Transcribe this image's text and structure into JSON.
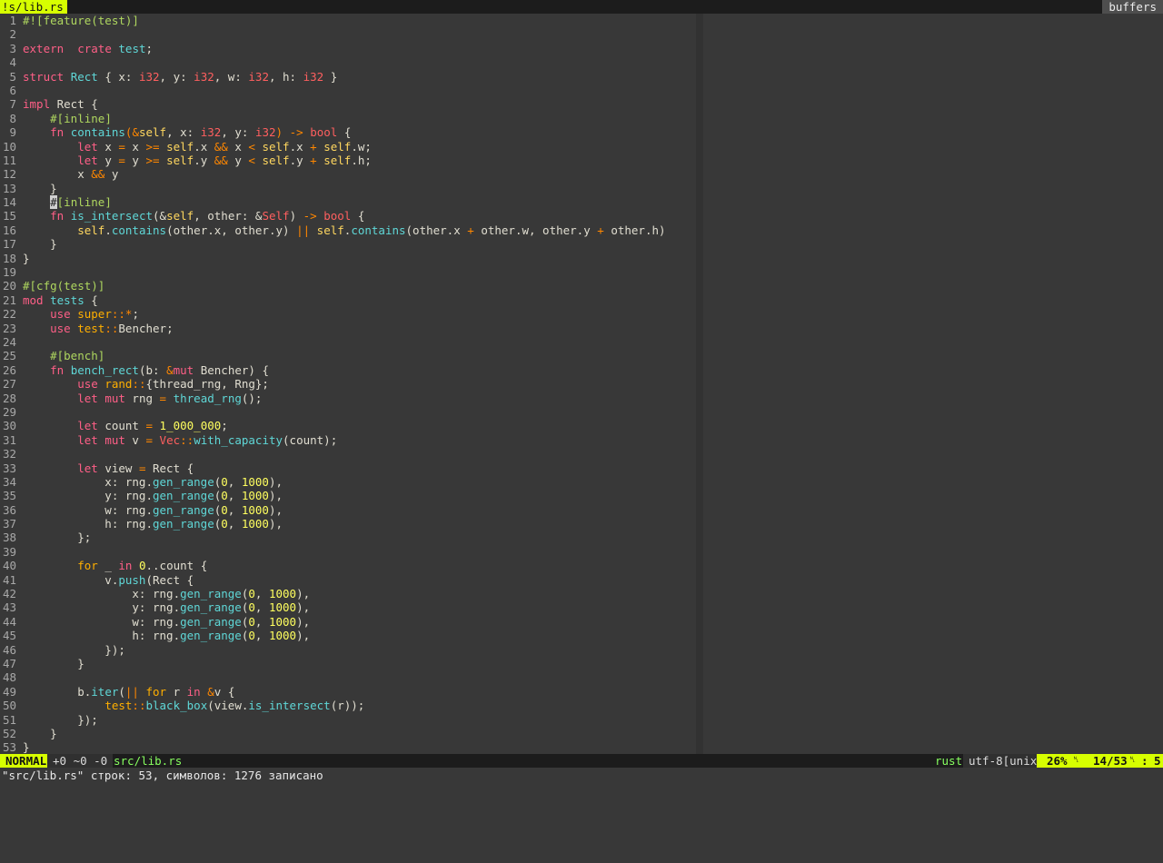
{
  "tabline": {
    "active_tab": "!s/lib.rs",
    "buffers_label": "buffers"
  },
  "editor": {
    "language": "rust",
    "lines": [
      [
        [
          "attr",
          "#![feature(test)]"
        ]
      ],
      [],
      [
        [
          "kw",
          "extern"
        ],
        [
          "",
          "  "
        ],
        [
          "kw",
          "crate"
        ],
        [
          "",
          " "
        ],
        [
          "fn",
          "test"
        ],
        [
          "",
          ";"
        ]
      ],
      [],
      [
        [
          "kw",
          "struct"
        ],
        [
          "",
          " "
        ],
        [
          "fn",
          "Rect"
        ],
        [
          "",
          " { x: "
        ],
        [
          "ty",
          "i32"
        ],
        [
          "",
          ", y: "
        ],
        [
          "ty",
          "i32"
        ],
        [
          "",
          ", w: "
        ],
        [
          "ty",
          "i32"
        ],
        [
          "",
          ", h: "
        ],
        [
          "ty",
          "i32"
        ],
        [
          "",
          " }"
        ]
      ],
      [],
      [
        [
          "kw",
          "impl"
        ],
        [
          "",
          " Rect {"
        ]
      ],
      [
        [
          "",
          "    "
        ],
        [
          "attr",
          "#[inline]"
        ]
      ],
      [
        [
          "",
          "    "
        ],
        [
          "kw",
          "fn"
        ],
        [
          "",
          " "
        ],
        [
          "fn",
          "contains"
        ],
        [
          "op",
          "("
        ],
        [
          "op",
          "&"
        ],
        [
          "slf",
          "self"
        ],
        [
          "",
          ", x: "
        ],
        [
          "ty",
          "i32"
        ],
        [
          "",
          ", y: "
        ],
        [
          "ty",
          "i32"
        ],
        [
          "op",
          ")"
        ],
        [
          "",
          " "
        ],
        [
          "op",
          "->"
        ],
        [
          "",
          " "
        ],
        [
          "ty",
          "bool"
        ],
        [
          "",
          " {"
        ]
      ],
      [
        [
          "",
          "        "
        ],
        [
          "kw",
          "let"
        ],
        [
          "",
          " x "
        ],
        [
          "op",
          "="
        ],
        [
          "",
          " x "
        ],
        [
          "op",
          ">="
        ],
        [
          "",
          " "
        ],
        [
          "slf",
          "self"
        ],
        [
          "",
          ".x "
        ],
        [
          "op",
          "&&"
        ],
        [
          "",
          " x "
        ],
        [
          "op",
          "<"
        ],
        [
          "",
          " "
        ],
        [
          "slf",
          "self"
        ],
        [
          "",
          ".x "
        ],
        [
          "op",
          "+"
        ],
        [
          "",
          " "
        ],
        [
          "slf",
          "self"
        ],
        [
          "",
          ".w;"
        ]
      ],
      [
        [
          "",
          "        "
        ],
        [
          "kw",
          "let"
        ],
        [
          "",
          " y "
        ],
        [
          "op",
          "="
        ],
        [
          "",
          " y "
        ],
        [
          "op",
          ">="
        ],
        [
          "",
          " "
        ],
        [
          "slf",
          "self"
        ],
        [
          "",
          ".y "
        ],
        [
          "op",
          "&&"
        ],
        [
          "",
          " y "
        ],
        [
          "op",
          "<"
        ],
        [
          "",
          " "
        ],
        [
          "slf",
          "self"
        ],
        [
          "",
          ".y "
        ],
        [
          "op",
          "+"
        ],
        [
          "",
          " "
        ],
        [
          "slf",
          "self"
        ],
        [
          "",
          ".h;"
        ]
      ],
      [
        [
          "",
          "        x "
        ],
        [
          "op",
          "&&"
        ],
        [
          "",
          " y"
        ]
      ],
      [
        [
          "",
          "    }"
        ]
      ],
      [
        [
          "",
          "    "
        ],
        [
          "cur",
          "#"
        ],
        [
          "attr",
          "[inline]"
        ]
      ],
      [
        [
          "",
          "    "
        ],
        [
          "kw",
          "fn"
        ],
        [
          "",
          " "
        ],
        [
          "fn",
          "is_intersect"
        ],
        [
          "",
          "(&"
        ],
        [
          "slf",
          "self"
        ],
        [
          "",
          ", other: &"
        ],
        [
          "ty",
          "Self"
        ],
        [
          "",
          ") "
        ],
        [
          "op",
          "->"
        ],
        [
          "",
          " "
        ],
        [
          "ty",
          "bool"
        ],
        [
          "",
          " {"
        ]
      ],
      [
        [
          "",
          "        "
        ],
        [
          "slf",
          "self"
        ],
        [
          "",
          "."
        ],
        [
          "fn",
          "contains"
        ],
        [
          "",
          "(other.x, other.y) "
        ],
        [
          "op",
          "||"
        ],
        [
          "",
          " "
        ],
        [
          "slf",
          "self"
        ],
        [
          "",
          "."
        ],
        [
          "fn",
          "contains"
        ],
        [
          "",
          "(other.x "
        ],
        [
          "op",
          "+"
        ],
        [
          "",
          " other.w, other.y "
        ],
        [
          "op",
          "+"
        ],
        [
          "",
          " other.h)"
        ]
      ],
      [
        [
          "",
          "    }"
        ]
      ],
      [
        [
          "",
          "}"
        ]
      ],
      [],
      [
        [
          "attr",
          "#[cfg(test)]"
        ]
      ],
      [
        [
          "kw",
          "mod"
        ],
        [
          "",
          " "
        ],
        [
          "fn",
          "tests"
        ],
        [
          "",
          " {"
        ]
      ],
      [
        [
          "",
          "    "
        ],
        [
          "kw",
          "use"
        ],
        [
          "",
          " "
        ],
        [
          "kw2",
          "super"
        ],
        [
          "op",
          "::*"
        ],
        [
          "",
          ";"
        ]
      ],
      [
        [
          "",
          "    "
        ],
        [
          "kw",
          "use"
        ],
        [
          "",
          " "
        ],
        [
          "kw2",
          "test"
        ],
        [
          "op",
          "::"
        ],
        [
          "",
          "Bencher;"
        ]
      ],
      [],
      [
        [
          "",
          "    "
        ],
        [
          "attr",
          "#[bench]"
        ]
      ],
      [
        [
          "",
          "    "
        ],
        [
          "kw",
          "fn"
        ],
        [
          "",
          " "
        ],
        [
          "fn",
          "bench_rect"
        ],
        [
          "",
          "(b: "
        ],
        [
          "op",
          "&"
        ],
        [
          "kw",
          "mut"
        ],
        [
          "",
          " Bencher) {"
        ]
      ],
      [
        [
          "",
          "        "
        ],
        [
          "kw",
          "use"
        ],
        [
          "",
          " "
        ],
        [
          "kw2",
          "rand"
        ],
        [
          "op",
          "::"
        ],
        [
          "",
          "{thread_rng, Rng};"
        ]
      ],
      [
        [
          "",
          "        "
        ],
        [
          "kw",
          "let"
        ],
        [
          "",
          " "
        ],
        [
          "kw",
          "mut"
        ],
        [
          "",
          " rng "
        ],
        [
          "op",
          "="
        ],
        [
          "",
          " "
        ],
        [
          "fn",
          "thread_rng"
        ],
        [
          "",
          "();"
        ]
      ],
      [],
      [
        [
          "",
          "        "
        ],
        [
          "kw",
          "let"
        ],
        [
          "",
          " count "
        ],
        [
          "op",
          "="
        ],
        [
          "",
          " "
        ],
        [
          "num",
          "1_000_000"
        ],
        [
          "",
          ";"
        ]
      ],
      [
        [
          "",
          "        "
        ],
        [
          "kw",
          "let"
        ],
        [
          "",
          " "
        ],
        [
          "kw",
          "mut"
        ],
        [
          "",
          " v "
        ],
        [
          "op",
          "="
        ],
        [
          "",
          " "
        ],
        [
          "ty",
          "Vec"
        ],
        [
          "op",
          "::"
        ],
        [
          "fn",
          "with_capacity"
        ],
        [
          "",
          "(count);"
        ]
      ],
      [],
      [
        [
          "",
          "        "
        ],
        [
          "kw",
          "let"
        ],
        [
          "",
          " view "
        ],
        [
          "op",
          "="
        ],
        [
          "",
          " Rect {"
        ]
      ],
      [
        [
          "",
          "            x: rng."
        ],
        [
          "fn",
          "gen_range"
        ],
        [
          "",
          "("
        ],
        [
          "num",
          "0"
        ],
        [
          "",
          ", "
        ],
        [
          "num",
          "1000"
        ],
        [
          "",
          "),"
        ]
      ],
      [
        [
          "",
          "            y: rng."
        ],
        [
          "fn",
          "gen_range"
        ],
        [
          "",
          "("
        ],
        [
          "num",
          "0"
        ],
        [
          "",
          ", "
        ],
        [
          "num",
          "1000"
        ],
        [
          "",
          "),"
        ]
      ],
      [
        [
          "",
          "            w: rng."
        ],
        [
          "fn",
          "gen_range"
        ],
        [
          "",
          "("
        ],
        [
          "num",
          "0"
        ],
        [
          "",
          ", "
        ],
        [
          "num",
          "1000"
        ],
        [
          "",
          "),"
        ]
      ],
      [
        [
          "",
          "            h: rng."
        ],
        [
          "fn",
          "gen_range"
        ],
        [
          "",
          "("
        ],
        [
          "num",
          "0"
        ],
        [
          "",
          ", "
        ],
        [
          "num",
          "1000"
        ],
        [
          "",
          "),"
        ]
      ],
      [
        [
          "",
          "        };"
        ]
      ],
      [],
      [
        [
          "",
          "        "
        ],
        [
          "kw2",
          "for"
        ],
        [
          "",
          " _ "
        ],
        [
          "kw",
          "in"
        ],
        [
          "",
          " "
        ],
        [
          "num",
          "0"
        ],
        [
          "",
          "..count {"
        ]
      ],
      [
        [
          "",
          "            v."
        ],
        [
          "fn",
          "push"
        ],
        [
          "",
          "(Rect {"
        ]
      ],
      [
        [
          "",
          "                x: rng."
        ],
        [
          "fn",
          "gen_range"
        ],
        [
          "",
          "("
        ],
        [
          "num",
          "0"
        ],
        [
          "",
          ", "
        ],
        [
          "num",
          "1000"
        ],
        [
          "",
          "),"
        ]
      ],
      [
        [
          "",
          "                y: rng."
        ],
        [
          "fn",
          "gen_range"
        ],
        [
          "",
          "("
        ],
        [
          "num",
          "0"
        ],
        [
          "",
          ", "
        ],
        [
          "num",
          "1000"
        ],
        [
          "",
          "),"
        ]
      ],
      [
        [
          "",
          "                w: rng."
        ],
        [
          "fn",
          "gen_range"
        ],
        [
          "",
          "("
        ],
        [
          "num",
          "0"
        ],
        [
          "",
          ", "
        ],
        [
          "num",
          "1000"
        ],
        [
          "",
          "),"
        ]
      ],
      [
        [
          "",
          "                h: rng."
        ],
        [
          "fn",
          "gen_range"
        ],
        [
          "",
          "("
        ],
        [
          "num",
          "0"
        ],
        [
          "",
          ", "
        ],
        [
          "num",
          "1000"
        ],
        [
          "",
          "),"
        ]
      ],
      [
        [
          "",
          "            });"
        ]
      ],
      [
        [
          "",
          "        }"
        ]
      ],
      [],
      [
        [
          "",
          "        b."
        ],
        [
          "fn",
          "iter"
        ],
        [
          "",
          "("
        ],
        [
          "op",
          "||"
        ],
        [
          "",
          " "
        ],
        [
          "kw2",
          "for"
        ],
        [
          "",
          " r "
        ],
        [
          "kw",
          "in"
        ],
        [
          "",
          " "
        ],
        [
          "op",
          "&"
        ],
        [
          "",
          "v {"
        ]
      ],
      [
        [
          "",
          "            "
        ],
        [
          "kw2",
          "test"
        ],
        [
          "op",
          "::"
        ],
        [
          "fn",
          "black_box"
        ],
        [
          "",
          "(view."
        ],
        [
          "fn",
          "is_intersect"
        ],
        [
          "",
          "(r));"
        ]
      ],
      [
        [
          "",
          "        });"
        ]
      ],
      [
        [
          "",
          "    }"
        ]
      ],
      [
        [
          "",
          "}"
        ]
      ]
    ]
  },
  "statusline": {
    "mode": "NORMAL",
    "hunks": "+0 ~0 -0",
    "filename": "src/lib.rs",
    "filetype": "rust",
    "encoding": "utf-8[unix]",
    "percent": "26%",
    "line_icon": "␤",
    "line_pos": "14/53",
    "col_icon": "␤",
    "col_sep": ":",
    "col_pos": "5"
  },
  "cmdline": {
    "message": "\"src/lib.rs\" строк: 53, символов: 1276 записано"
  }
}
